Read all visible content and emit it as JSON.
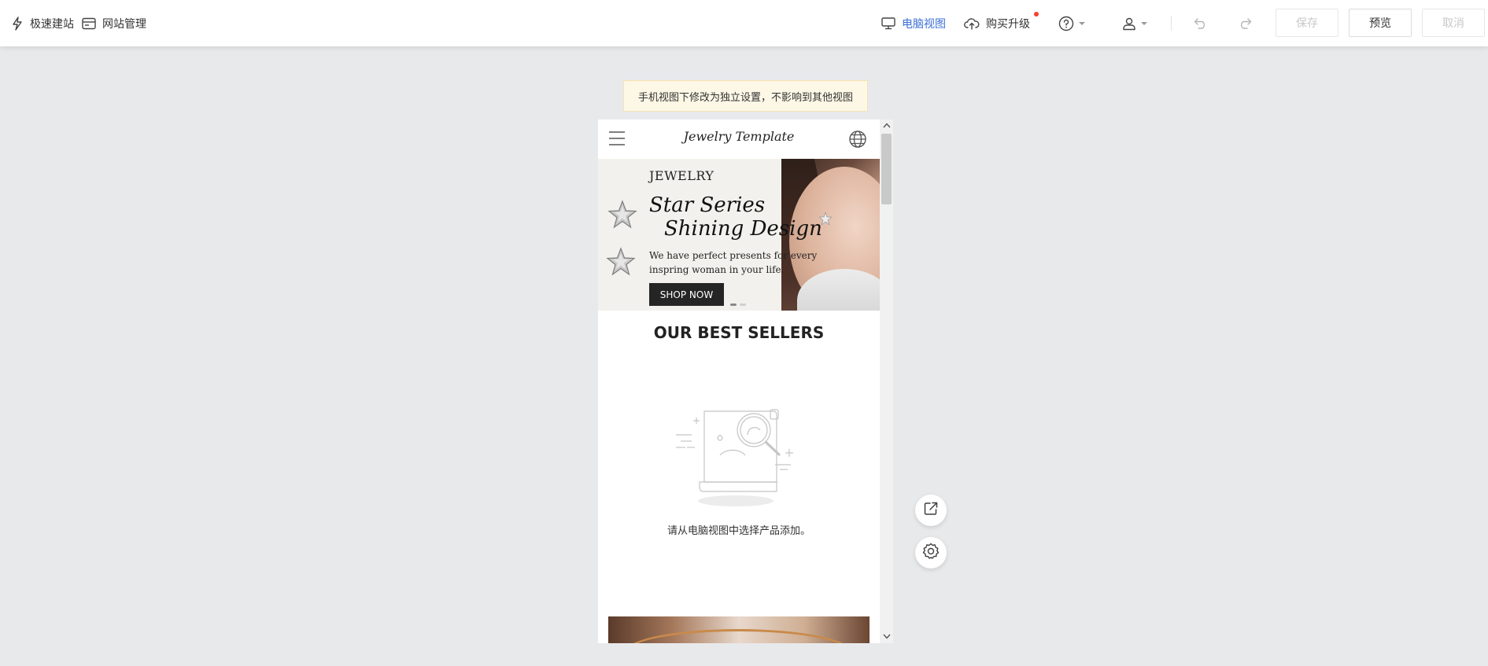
{
  "toolbar": {
    "quick_build_label": "极速建站",
    "site_manage_label": "网站管理",
    "desktop_view_label": "电脑视图",
    "upgrade_label": "购买升级",
    "save_label": "保存",
    "preview_label": "预览",
    "cancel_label": "取消"
  },
  "notice": {
    "text": "手机视图下修改为独立设置，不影响到其他视图"
  },
  "mobile": {
    "logo": "Jewelry Template",
    "banner": {
      "eyebrow": "JEWELRY",
      "title_line1": "Star Series",
      "title_line2": "Shining Design",
      "description": "We have perfect presents for every inspring woman in your life.",
      "cta": "SHOP NOW"
    },
    "best_sellers_title": "OUR BEST SELLERS",
    "empty_text": "请从电脑视图中选择产品添加。"
  },
  "colors": {
    "accent": "#3b6fd8",
    "notice_bg": "#fdf7e6",
    "canvas_bg": "#e8e9eb",
    "cta_bg": "#252525",
    "badge": "#ff3b30"
  },
  "icons": {
    "quick_build": "lightning-icon",
    "site_manage": "card-icon",
    "desktop_view": "monitor-icon",
    "upgrade": "cloud-upload-icon",
    "help": "question-circle-icon",
    "account": "user-icon",
    "undo": "undo-icon",
    "redo": "redo-icon",
    "menu": "hamburger-icon",
    "language": "globe-icon",
    "share": "share-icon",
    "settings": "gear-icon"
  }
}
